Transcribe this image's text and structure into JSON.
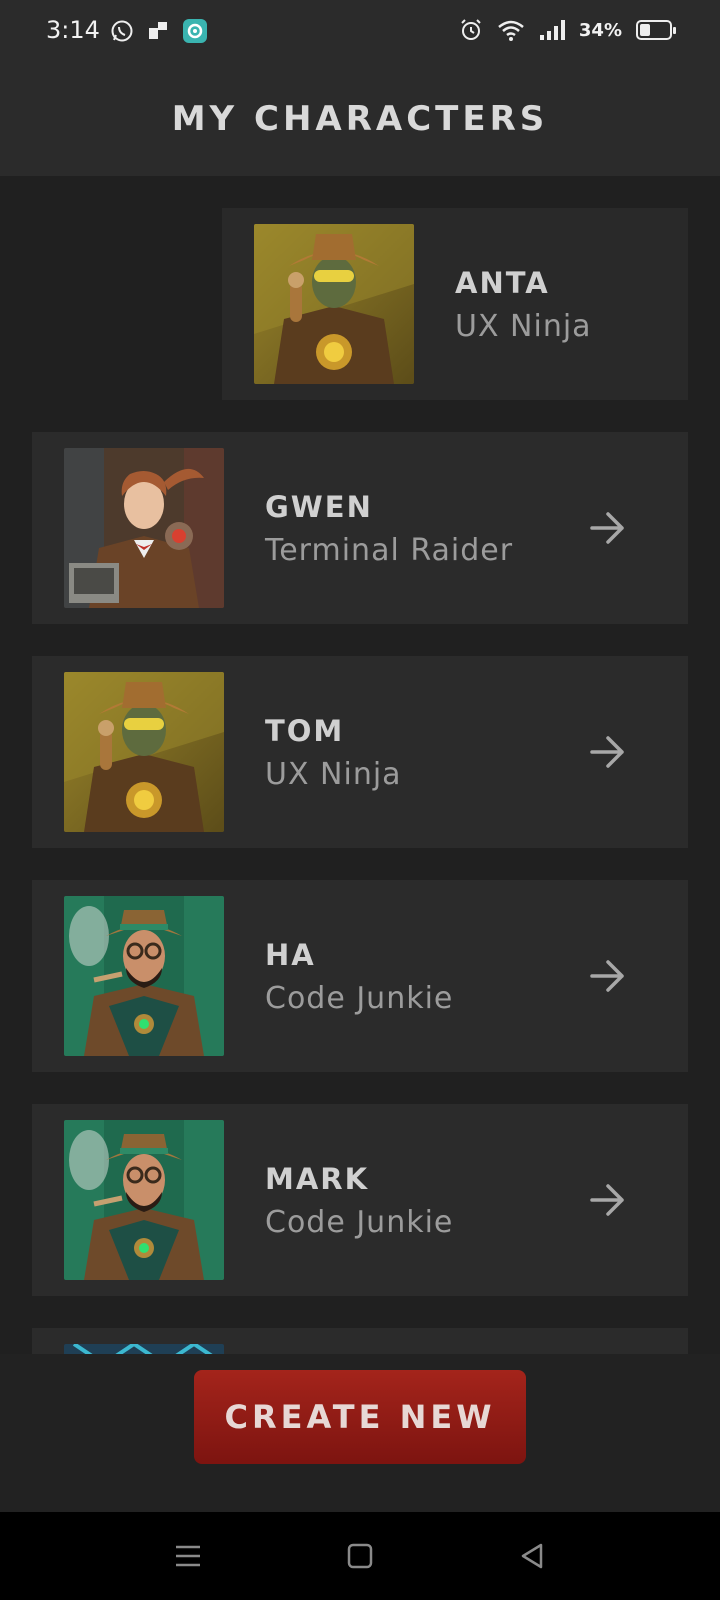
{
  "status_bar": {
    "time": "3:14",
    "battery_percent_text": "34%",
    "battery_level": 0.34,
    "left_icons": [
      "whatsapp-icon",
      "notification-icon",
      "app-icon"
    ],
    "right_icons": [
      "alarm-icon",
      "wifi-icon",
      "signal-icon",
      "battery-icon"
    ]
  },
  "header": {
    "title": "MY CHARACTERS"
  },
  "characters": [
    {
      "name": "ANTA",
      "role": "UX Ninja",
      "portrait": "ninja",
      "selected": true
    },
    {
      "name": "GWEN",
      "role": "Terminal Raider",
      "portrait": "raider",
      "selected": false
    },
    {
      "name": "TOM",
      "role": "UX Ninja",
      "portrait": "ninja",
      "selected": false
    },
    {
      "name": "HA",
      "role": "Code Junkie",
      "portrait": "junkie",
      "selected": false
    },
    {
      "name": "MARK",
      "role": "Code Junkie",
      "portrait": "junkie",
      "selected": false
    }
  ],
  "create_button": {
    "label": "CREATE NEW"
  },
  "nav": {
    "items": [
      "menu-icon",
      "home-icon",
      "back-icon"
    ]
  },
  "colors": {
    "background": "#202020",
    "card": "#2b2b2b",
    "accent": "#a4241b"
  }
}
